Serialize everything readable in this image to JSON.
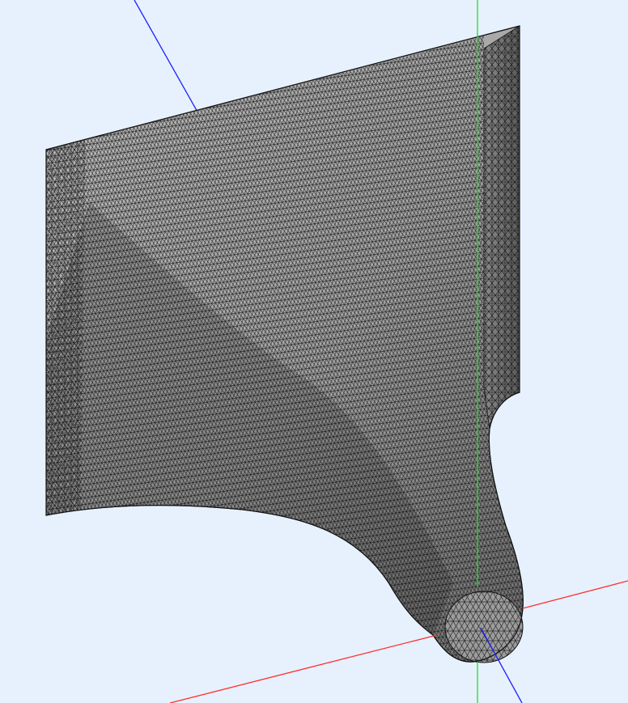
{
  "viewport": {
    "background": "#e6f1fd"
  },
  "axes": {
    "x_color": "#ff3030",
    "y_color": "#22dd22",
    "z_color": "#2020ff"
  },
  "mesh": {
    "surface_fill": "#b3b3b3",
    "shade_fill": "#8e8e8e",
    "edge_color": "#111111"
  }
}
